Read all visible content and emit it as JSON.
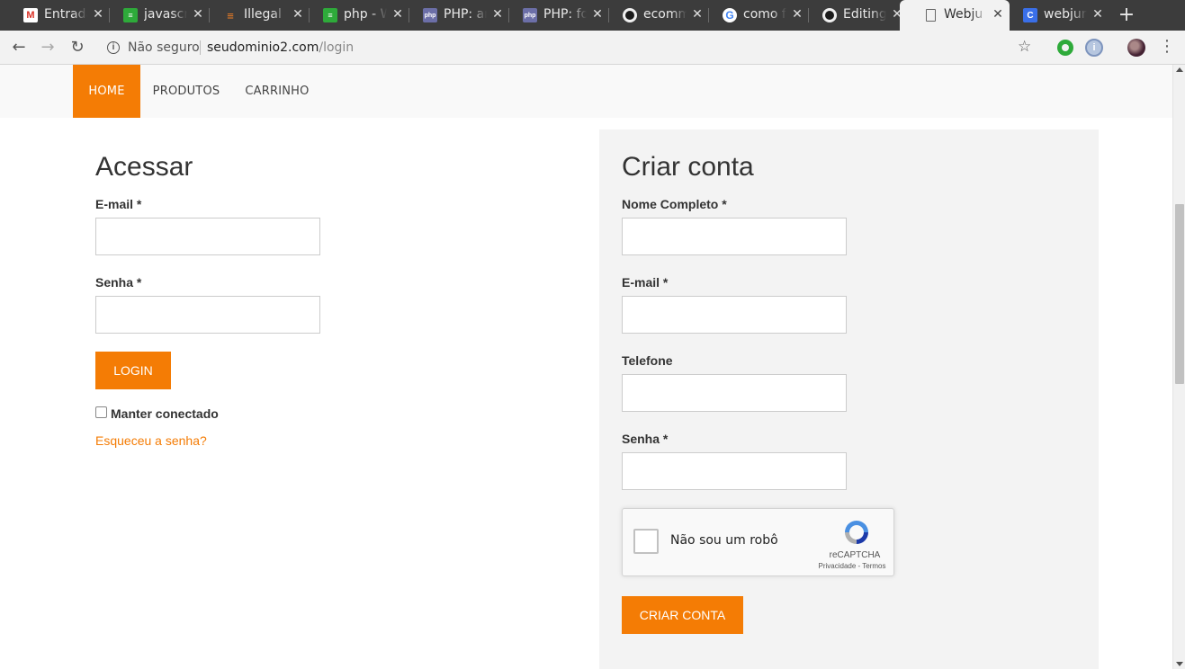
{
  "browser": {
    "tabs": [
      {
        "title": "Entrada",
        "icon": "gmail-icon",
        "color": "#d93025",
        "glyph": "M",
        "active": false
      },
      {
        "title": "javascript",
        "icon": "stackoverflow-pt-icon",
        "color": "#2eaa3a",
        "glyph": "S",
        "active": false
      },
      {
        "title": "Illegal",
        "icon": "stackoverflow-icon",
        "color": "#f48024",
        "glyph": "≡",
        "active": false
      },
      {
        "title": "php - W",
        "icon": "stackoverflow-pt-icon",
        "color": "#2eaa3a",
        "glyph": "S",
        "active": false
      },
      {
        "title": "PHP: ar",
        "icon": "php-icon",
        "color": "#6c6fa8",
        "glyph": "php",
        "active": false
      },
      {
        "title": "PHP: fo",
        "icon": "php-icon",
        "color": "#6c6fa8",
        "glyph": "php",
        "active": false
      },
      {
        "title": "ecomm",
        "icon": "github-icon",
        "color": "#1b1b1b",
        "glyph": "●",
        "active": false
      },
      {
        "title": "como f",
        "icon": "google-icon",
        "color": "#ffffff",
        "glyph": "G",
        "active": false
      },
      {
        "title": "Editing",
        "icon": "github-icon",
        "color": "#1b1b1b",
        "glyph": "●",
        "active": false
      },
      {
        "title": "Webju",
        "icon": "document-icon",
        "color": "#f2f2f2",
        "glyph": "▯",
        "active": true
      },
      {
        "title": "webjur",
        "icon": "webjump-icon",
        "color": "#3a6fe8",
        "glyph": "C",
        "active": false
      }
    ],
    "new_tab": "+",
    "close_glyph": "✕",
    "security_label": "Não seguro",
    "url_host": "seudominio2.com",
    "url_path": "/login"
  },
  "nav": {
    "items": [
      {
        "label": "HOME",
        "active": true
      },
      {
        "label": "PRODUTOS",
        "active": false
      },
      {
        "label": "CARRINHO",
        "active": false
      }
    ]
  },
  "login": {
    "title": "Acessar",
    "email_label": "E-mail *",
    "email_value": "",
    "password_label": "Senha *",
    "password_value": "",
    "submit_label": "LOGIN",
    "remember_label": "Manter conectado",
    "remember_checked": false,
    "forgot_link": "Esqueceu a senha?"
  },
  "register": {
    "title": "Criar conta",
    "name_label": "Nome Completo *",
    "email_label": "E-mail *",
    "phone_label": "Telefone",
    "password_label": "Senha *",
    "captcha_label": "Não sou um robô",
    "captcha_brand": "reCAPTCHA",
    "captcha_terms": "Privacidade - Termos",
    "submit_label": "CRIAR CONTA"
  },
  "colors": {
    "accent": "#f47c05",
    "panel_bg": "#f3f3f3",
    "nav_bg": "#f9f9f9"
  }
}
